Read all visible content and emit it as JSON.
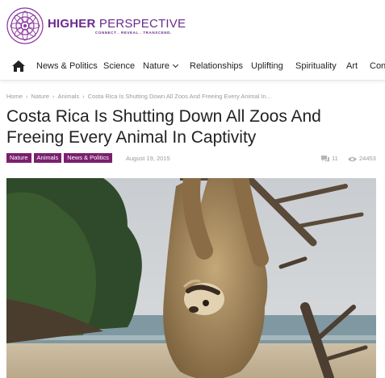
{
  "logo": {
    "title_bold": "HIGHER",
    "title_light": " PERSPECTIVE",
    "tagline": "CONNECT . REVEAL . TRANSCEND.",
    "brand_color": "#6a2a8e"
  },
  "nav": {
    "home_icon": "home-icon",
    "items": [
      {
        "label": "News & Politics"
      },
      {
        "label": "Science"
      },
      {
        "label": "Nature",
        "dropdown": true
      },
      {
        "label": "Relationships"
      },
      {
        "label": "Uplifting"
      },
      {
        "label": "Spirituality"
      },
      {
        "label": "Art"
      },
      {
        "label": "Con"
      }
    ]
  },
  "breadcrumb": {
    "items": [
      "Home",
      "Nature",
      "Animals",
      "Costa Rica Is Shutting Down All Zoos And Freeing Every Animal In..."
    ]
  },
  "article": {
    "title": "Costa Rica Is Shutting Down All Zoos And Freeing Every Animal In Captivity",
    "tags": [
      "Nature",
      "Animals",
      "News & Politics"
    ],
    "tag_color": "#7b1f6f",
    "date": "August 19, 2015",
    "comments": "11",
    "views": "24453",
    "hero_image": "sloth-hanging-on-branch-beach-photo"
  }
}
